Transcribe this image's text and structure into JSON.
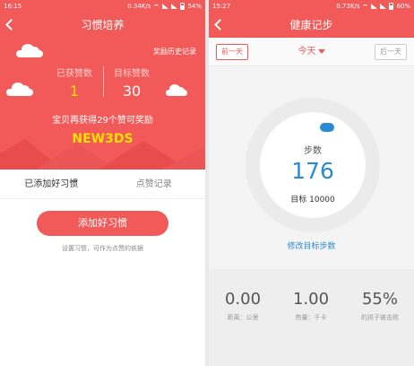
{
  "colors": {
    "primary_red": "#f25a5a",
    "accent_blue": "#2a8ad6",
    "highlight_yellow": "#ffe000"
  },
  "left": {
    "status_bar": {
      "time": "16:15",
      "speed": "0.34K/s",
      "battery": "54%"
    },
    "title": "习惯培养",
    "history_link": "奖励历史记录",
    "earned": {
      "label": "已获赞数",
      "value": "1"
    },
    "target": {
      "label": "目标赞数",
      "value": "30"
    },
    "reward_text": "宝贝再获得29个赞可奖励",
    "reward_prize": "NEW3DS",
    "tabs": [
      {
        "label": "已添加好习惯"
      },
      {
        "label": "点赞记录"
      }
    ],
    "add_button": "添加好习惯",
    "hint": "设置习惯，可作为点赞的依据"
  },
  "right": {
    "status_bar": {
      "time": "15:27",
      "speed": "0.73K/s",
      "battery": "60%"
    },
    "title": "健康记步",
    "prev_day": "前一天",
    "today": "今天",
    "next_day": "后一天",
    "ring": {
      "label": "步数",
      "steps": "176",
      "target": "目标 10000"
    },
    "modify_link": "修改目标步数",
    "metrics": [
      {
        "value": "0.00",
        "label": "距离：公里"
      },
      {
        "value": "1.00",
        "label": "热量：千卡"
      },
      {
        "value": "55%",
        "label": "的孩子被击败"
      }
    ]
  }
}
